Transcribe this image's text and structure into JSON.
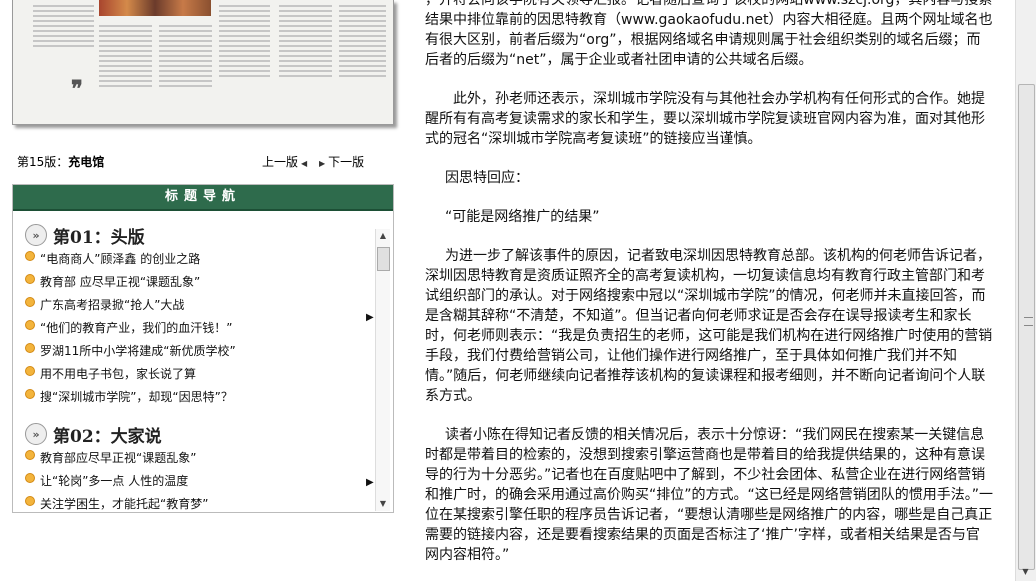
{
  "pager": {
    "label_prefix": "第15版：",
    "label_name": "充电馆",
    "prev": "上一版",
    "next": "下一版"
  },
  "nav": {
    "title": "标题导航",
    "sections": [
      {
        "title": "第01：头版",
        "items": [
          "“电商商人”顾泽鑫 的创业之路",
          "教育部 应尽早正视“课题乱象”",
          "广东高考招录掀“抢人”大战",
          "“他们的教育产业，我们的血汗钱！”",
          "罗湖11所中小学将建成“新优质学校”",
          "用不用电子书包，家长说了算",
          "搜“深圳城市学院”，却现“因思特”？"
        ]
      },
      {
        "title": "第02：大家说",
        "items": [
          "教育部应尽早正视“课题乱象”",
          "让“轮岗”多一点 人性的温度",
          "关注学困生，才能托起“教育梦”"
        ]
      }
    ]
  },
  "article": {
    "paragraphs": [
      "，并将会向该学院有关领导汇报。”记者随后查询了该校的网站www.szcj.org，其内容与搜索结果中排位靠前的因思特教育（www.gaokaofudu.net）内容大相径庭。且两个网址域名也有很大区别，前者后缀为“org”，根据网络域名申请规则属于社会组织类别的域名后缀；而后者的后缀为“net”，属于企业或者社团申请的公共域名后缀。",
      "此外，孙老师还表示，深圳城市学院没有与其他社会办学机构有任何形式的合作。她提醒所有有高考复读需求的家长和学生，要以深圳城市学院复读班官网内容为准，面对其他形式的冠名“深圳城市学院高考复读班”的链接应当谨慎。",
      "因思特回应：",
      "“可能是网络推广的结果”",
      "为进一步了解该事件的原因，记者致电深圳因思特教育总部。该机构的何老师告诉记者，深圳因思特教育是资质证照齐全的高考复读机构，一切复读信息均有教育行政主管部门和考试组织部门的承认。对于网络搜索中冠以“深圳城市学院”的情况，何老师并未直接回答，而是含糊其辞称“不清楚，不知道”。但当记者向何老师求证是否会存在误导报读考生和家长时，何老师则表示：“我是负责招生的老师，这可能是我们机构在进行网络推广时使用的营销手段，我们付费给营销公司，让他们操作进行网络推广，至于具体如何推广我们并不知情。”随后，何老师继续向记者推荐该机构的复读课程和报考细则，并不断向记者询问个人联系方式。",
      "读者小陈在得知记者反馈的相关情况后，表示十分惊讶：“我们网民在搜索某一关键信息时都是带着目的检索的，没想到搜索引擎运营商也是带着目的给我提供结果的，这种有意误导的行为十分恶劣。”记者也在百度贴吧中了解到，不少社会团体、私营企业在进行网络营销和推广时，的确会采用通过高价购买“排位”的方式。“这已经是网络营销团队的惯用手法。”一位在某搜索引擎任职的程序员告诉记者，“要想认清哪些是网络推广的内容，哪些是自己真正需要的链接内容，还是要看搜索结果的页面是否标注了‘推广’字样，或者相关结果是否与官网内容相符。”"
    ]
  }
}
